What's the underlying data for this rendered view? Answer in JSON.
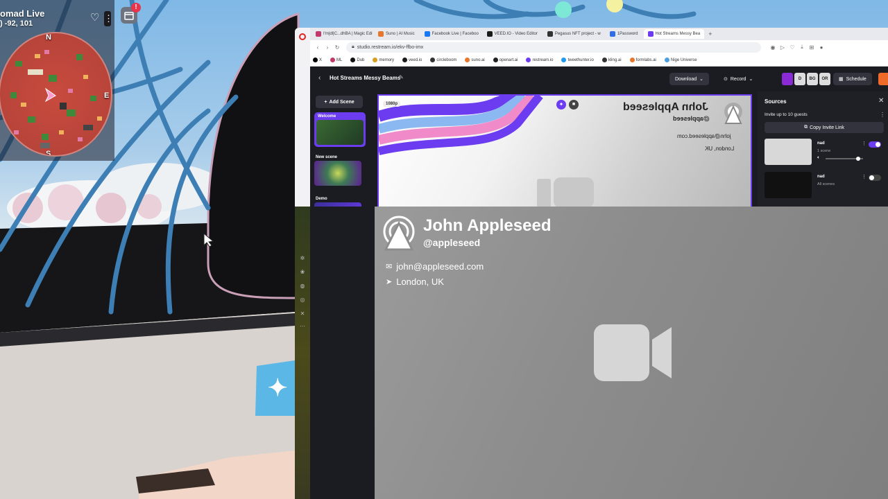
{
  "game": {
    "title": "omad Live",
    "coords": ") -92, 101",
    "notification_badge": "!",
    "compass": {
      "north": "N",
      "south": "S",
      "east": "E"
    }
  },
  "browser": {
    "tabs": [
      {
        "label": "I'm|dl|C...dhBA | Magic Edit",
        "color": "#c33a6a",
        "active": false
      },
      {
        "label": "Suno | AI Music",
        "color": "#e8772e",
        "active": false
      },
      {
        "label": "Facebook Live | Faceboo",
        "color": "#1877f2",
        "active": false
      },
      {
        "label": "VEED.IO - Video Editor",
        "color": "#1b1b1b",
        "active": false
      },
      {
        "label": "Pegasus NFT project - w",
        "color": "#333333",
        "active": false
      },
      {
        "label": "1Password",
        "color": "#2f6ee8",
        "active": false
      },
      {
        "label": "Hot Streams Messy Bea",
        "color": "#6b3cf0",
        "active": true
      }
    ],
    "url": "studio.restream.io/ekv-ffbo-imx",
    "bookmarks": [
      {
        "label": "X",
        "color": "#000000"
      },
      {
        "label": "ML",
        "color": "#c33a6a"
      },
      {
        "label": "Dub",
        "color": "#111111"
      },
      {
        "label": "memory",
        "color": "#d6a020"
      },
      {
        "label": "veed.io",
        "color": "#1b1b1b"
      },
      {
        "label": "circleboom",
        "color": "#333333"
      },
      {
        "label": "suno.ai",
        "color": "#e8772e"
      },
      {
        "label": "openart.ai",
        "color": "#222222"
      },
      {
        "label": "restream.io",
        "color": "#6b3cf0"
      },
      {
        "label": "tweethunter.io",
        "color": "#1d9bf0"
      },
      {
        "label": "kling.ai",
        "color": "#333333"
      },
      {
        "label": "formlabs.ai",
        "color": "#e8772e"
      },
      {
        "label": "Nige Universe",
        "color": "#4aa0e0"
      }
    ]
  },
  "studio": {
    "name": "Hot Streams Messy Beams",
    "download": "Download",
    "record": "Record",
    "schedule": "Schedule",
    "avatars": [
      "",
      "D",
      "BG",
      "OR"
    ],
    "add_scene": "Add Scene",
    "scenes": [
      {
        "label": "Welcome"
      },
      {
        "label": "New scene"
      },
      {
        "label": "Demo"
      }
    ],
    "resolution": "1080p",
    "canvas": {
      "name": "John Appleseed",
      "handle": "@appleseed",
      "email": "john@appleseed.com",
      "location": "London, UK"
    }
  },
  "sources": {
    "title": "Sources",
    "invite": "Invite up to 10 guests",
    "copy_link": "Copy Invite Link",
    "guests": [
      {
        "name": "nad",
        "sub": "1 scene",
        "enabled": true
      },
      {
        "name": "nad",
        "sub": "All scenes",
        "enabled": false
      }
    ]
  },
  "zoom": {
    "name": "John Appleseed",
    "handle": "@appleseed",
    "email": "john@appleseed.com",
    "location": "London, UK"
  },
  "colors": {
    "accent": "#6b3cf0",
    "go_live": "#f06a2a",
    "badge": "#e8334a"
  }
}
